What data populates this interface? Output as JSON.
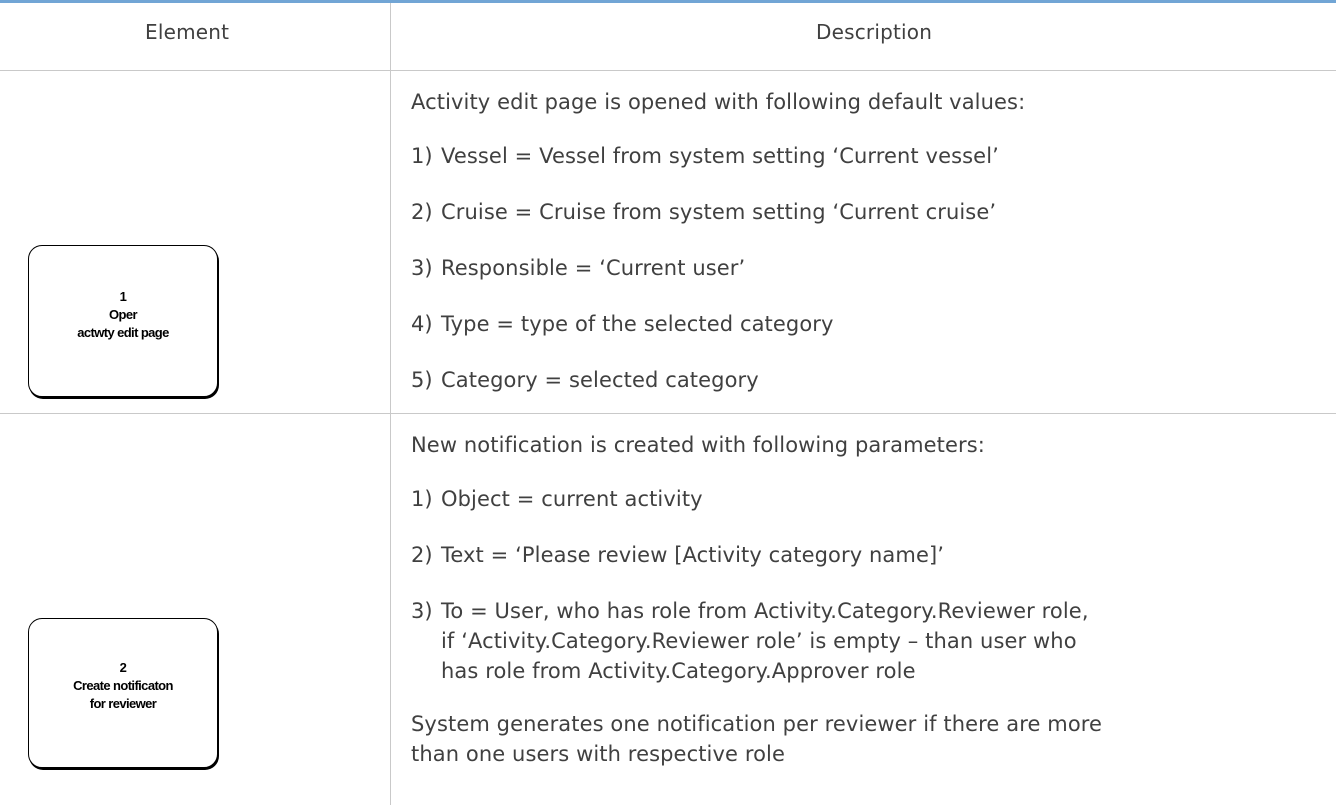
{
  "header": {
    "element": "Element",
    "description": "Description"
  },
  "rows": [
    {
      "shape": {
        "number": "1",
        "line1": "Oper",
        "line2": "actwty edit page"
      },
      "intro": "Activity edit page is opened with following default values:",
      "items": [
        {
          "num": "1)",
          "text": "Vessel = Vessel from system setting ‘Current vessel’"
        },
        {
          "num": "2)",
          "text": "Cruise = Cruise from system setting ‘Current cruise’"
        },
        {
          "num": "3)",
          "text": "Responsible = ‘Current user’"
        },
        {
          "num": "4)",
          "text": "Type = type of the selected category"
        },
        {
          "num": "5)",
          "text": "Category = selected category"
        }
      ]
    },
    {
      "shape": {
        "number": "2",
        "line1": "Create notificaton",
        "line2": "for reviewer"
      },
      "intro": "New notification is created with following parameters:",
      "items": [
        {
          "num": "1)",
          "text": "Object = current activity"
        },
        {
          "num": "2)",
          "text": "Text = ‘Please review [Activity category name]’"
        },
        {
          "num": "3)",
          "lines": [
            "To = User, who has role from Activity.Category.Reviewer role,",
            "if ‘Activity.Category.Reviewer role’ is empty – than user who",
            "has role from Activity.Category.Approver role"
          ]
        }
      ],
      "footer_lines": [
        "System generates one notification per reviewer if there are more",
        "than one users with respective role"
      ]
    }
  ]
}
